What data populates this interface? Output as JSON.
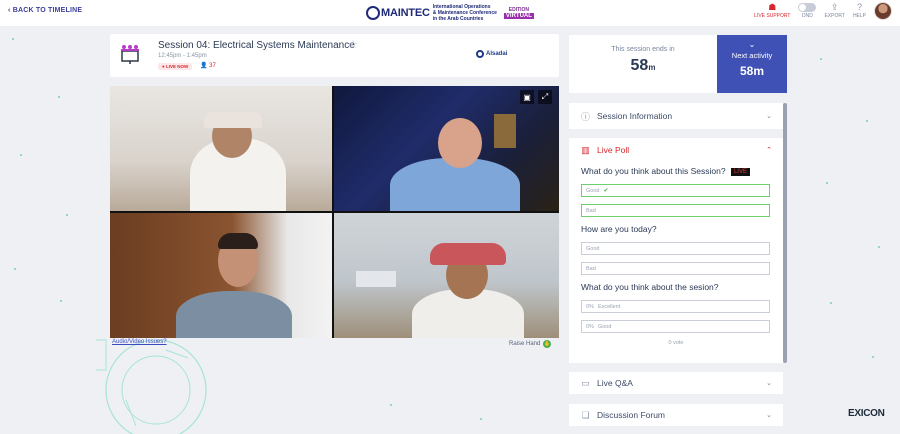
{
  "header": {
    "back_label": "BACK TO TIMELINE",
    "brand_name": "MAINTEC",
    "brand_line1": "International Operations",
    "brand_line2": "& Maintenance Conference",
    "brand_line3": "in the Arab Countries",
    "brand_edition": "EDITION",
    "brand_virtual": "VIRTUAL",
    "actions": [
      {
        "label": "LIVE SUPPORT"
      },
      {
        "label": "DND"
      },
      {
        "label": "EXPORT"
      },
      {
        "label": "HELP"
      }
    ]
  },
  "session": {
    "title": "Session 04: Electrical Systems Maintenance",
    "time": "12:45pm - 1:45pm",
    "live_badge": "● LIVE NOW",
    "viewers": "37",
    "sponsor": "Alsadai"
  },
  "video": {
    "av_issues_link": "Audio/Video Issues?",
    "raise_hand": "Raise Hand"
  },
  "timer": {
    "label": "This session ends in",
    "value": "58",
    "unit": "m"
  },
  "next_activity": {
    "label": "Next activity",
    "value": "58m"
  },
  "panels": {
    "info": "Session Information",
    "poll": "Live Poll",
    "qa": "Live Q&A",
    "forum": "Discussion Forum"
  },
  "poll": {
    "live_tag": "LIVE",
    "questions": [
      {
        "text": "What do you think about this Session?",
        "options": [
          "Good",
          "Bad"
        ]
      },
      {
        "text": "How are you today?",
        "options": [
          "Good",
          "Bad"
        ]
      },
      {
        "text": "What do you think about the sesion?",
        "options": [
          "Excellent",
          "Good"
        ],
        "percents": [
          "0%",
          "0%"
        ]
      }
    ],
    "votes": "0 vote"
  },
  "footer": {
    "logo": "EXICON"
  },
  "colors": {
    "accent": "#3f51b5",
    "live": "#d8262e",
    "selected_border": "#6fcf6f"
  }
}
